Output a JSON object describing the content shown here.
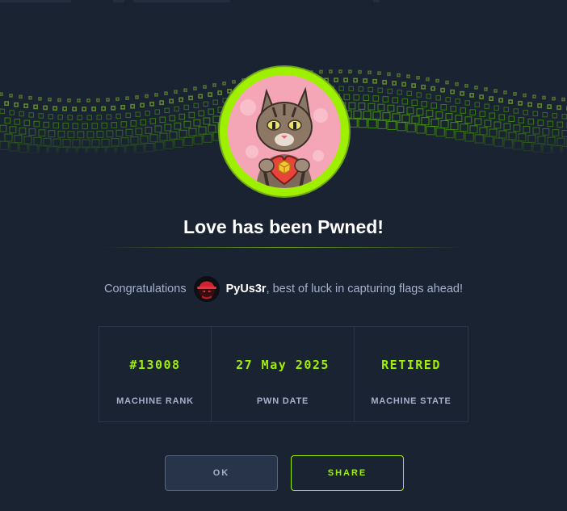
{
  "dialog": {
    "title": "Love has been Pwned!",
    "congrats_prefix": "Congratulations",
    "username": "PyUs3r",
    "congrats_suffix": ", best of luck in capturing flags ahead!"
  },
  "stats": [
    {
      "value": "#13008",
      "label": "MACHINE RANK"
    },
    {
      "value": "27 May 2025",
      "label": "PWN DATE"
    },
    {
      "value": "RETIRED",
      "label": "MACHINE STATE"
    }
  ],
  "buttons": {
    "ok": "OK",
    "share": "SHARE"
  },
  "icons": {
    "machine_avatar": "cat-holding-heart-icon",
    "user_avatar": "hacker-hat-icon"
  },
  "colors": {
    "accent": "#9fef00",
    "background": "#1a2332",
    "text_muted": "#a4b1cd",
    "border": "#2a3446"
  }
}
